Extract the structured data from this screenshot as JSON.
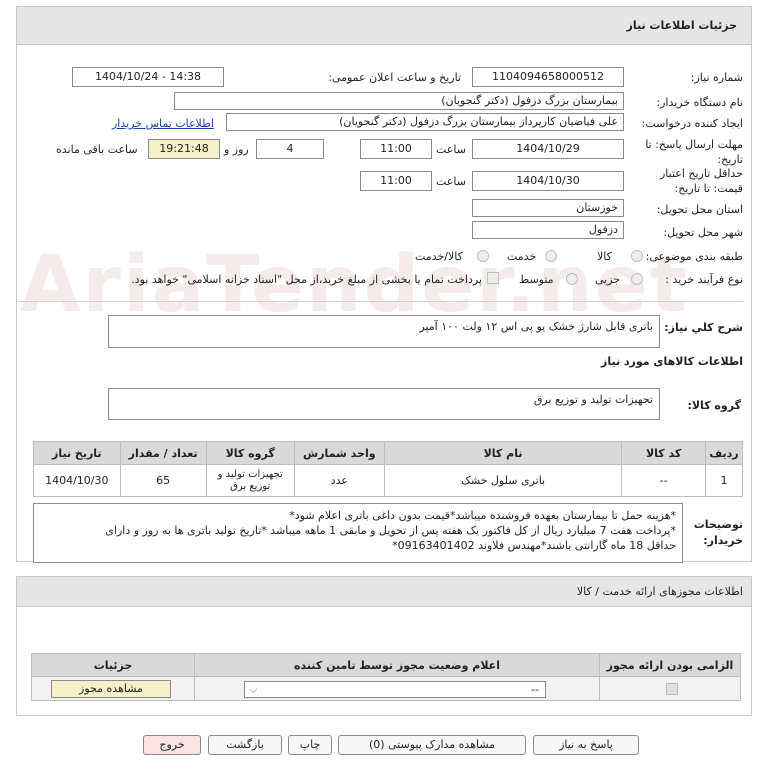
{
  "panel_title": "جزئیات اطلاعات نیاز",
  "fields": {
    "need_number_label": "شماره نیاز:",
    "need_number": "1104094658000512",
    "announce_label": "تاریخ و ساعت اعلان عمومی:",
    "announce_value": "1404/10/24 - 14:38",
    "buyer_org_label": "نام دستگاه خریدار:",
    "buyer_org": "بیمارستان بزرگ دزفول (دکتر گنجویان)",
    "creator_label": "ایجاد کننده درخواست:",
    "creator": "علی فیاضیان کارپرداز بیمارستان بزرگ دزفول (دکتر گنجویان)",
    "contact_link": "اطلاعات تماس خریدار",
    "deadline_label": "مهلت ارسال پاسخ: تا تاریخ:",
    "deadline_date": "1404/10/29",
    "time_label": "ساعت",
    "deadline_time": "11:00",
    "days_value": "4",
    "days_label": "روز و",
    "remaining_time": "19:21:48",
    "remaining_label": "ساعت باقی مانده",
    "price_validity_label": "حداقل تاریخ اعتبار قیمت: تا تاریخ:",
    "price_validity_date": "1404/10/30",
    "price_validity_time": "11:00",
    "province_label": "استان محل تحویل:",
    "province": "خوزستان",
    "city_label": "شهر محل تحویل:",
    "city": "دزفول",
    "category_label": "طبقه بندی موضوعی:",
    "category_options": [
      "کالا",
      "خدمت",
      "کالا/خدمت"
    ],
    "process_label": "نوع فرآیند خرید :",
    "process_options": [
      "جزیی",
      "متوسط"
    ],
    "payment_note": "پرداخت تمام یا بخشی از مبلغ خرید،از محل \"اسناد خزانه اسلامی\" خواهد بود."
  },
  "summary": {
    "label": "شرح كلي نياز:",
    "value": "باتری قابل شارژ خشک یو پی اس ۱۲ ولت ۱۰۰ آمپر"
  },
  "goods_section": {
    "title": "اطلاعات کالاهای مورد نیاز",
    "group_label": "گروه کالا:",
    "group_value": "تجهیزات تولید و توزیع برق"
  },
  "items_table": {
    "headers": [
      "ردیف",
      "کد کالا",
      "نام کالا",
      "واحد شمارش",
      "گروه کالا",
      "تعداد / مقدار",
      "تاریخ نیاز"
    ],
    "rows": [
      [
        "1",
        "--",
        "باتری سلول خشک",
        "عدد",
        "تجهیزات تولید و توزیع برق",
        "65",
        "1404/10/30"
      ]
    ]
  },
  "buyer_notes": {
    "label": "توضیحات خریدار:",
    "lines": [
      "*هزینه حمل تا بیمارستان بعهده فروشنده میباشد*قیمت بدون داغی باتری اعلام شود*",
      "*پرداخت هفت 7 میلیارد ریال از کل فاکتور یک هفته پس از تحویل و مابقی 1 ماهه میباشد *تاریخ تولید باتری ها به روز و دارای",
      "حداقل 18 ماه گارانتی باشند*مهندس فلاوند 09163401402*"
    ]
  },
  "license_panel": {
    "title": "اطلاعات مجوزهای ارائه خدمت / کالا",
    "headers": [
      "الزامی بودن ارائه مجوز",
      "اعلام وضعیت مجوز توسط تامین کننده",
      "جزئیات"
    ],
    "select_value": "--",
    "view_button": "مشاهده مجوز"
  },
  "footer_buttons": {
    "reply": "پاسخ به نیاز",
    "view_docs": "مشاهده مدارک پیوستی (0)",
    "print": "چاپ",
    "back": "بازگشت",
    "exit": "خروج"
  },
  "colors": {
    "header_bg": "#e6e6e6",
    "link": "#1a3fa8",
    "exit_bg": "#fbe3e3",
    "highlight": "#f6f0c9"
  }
}
